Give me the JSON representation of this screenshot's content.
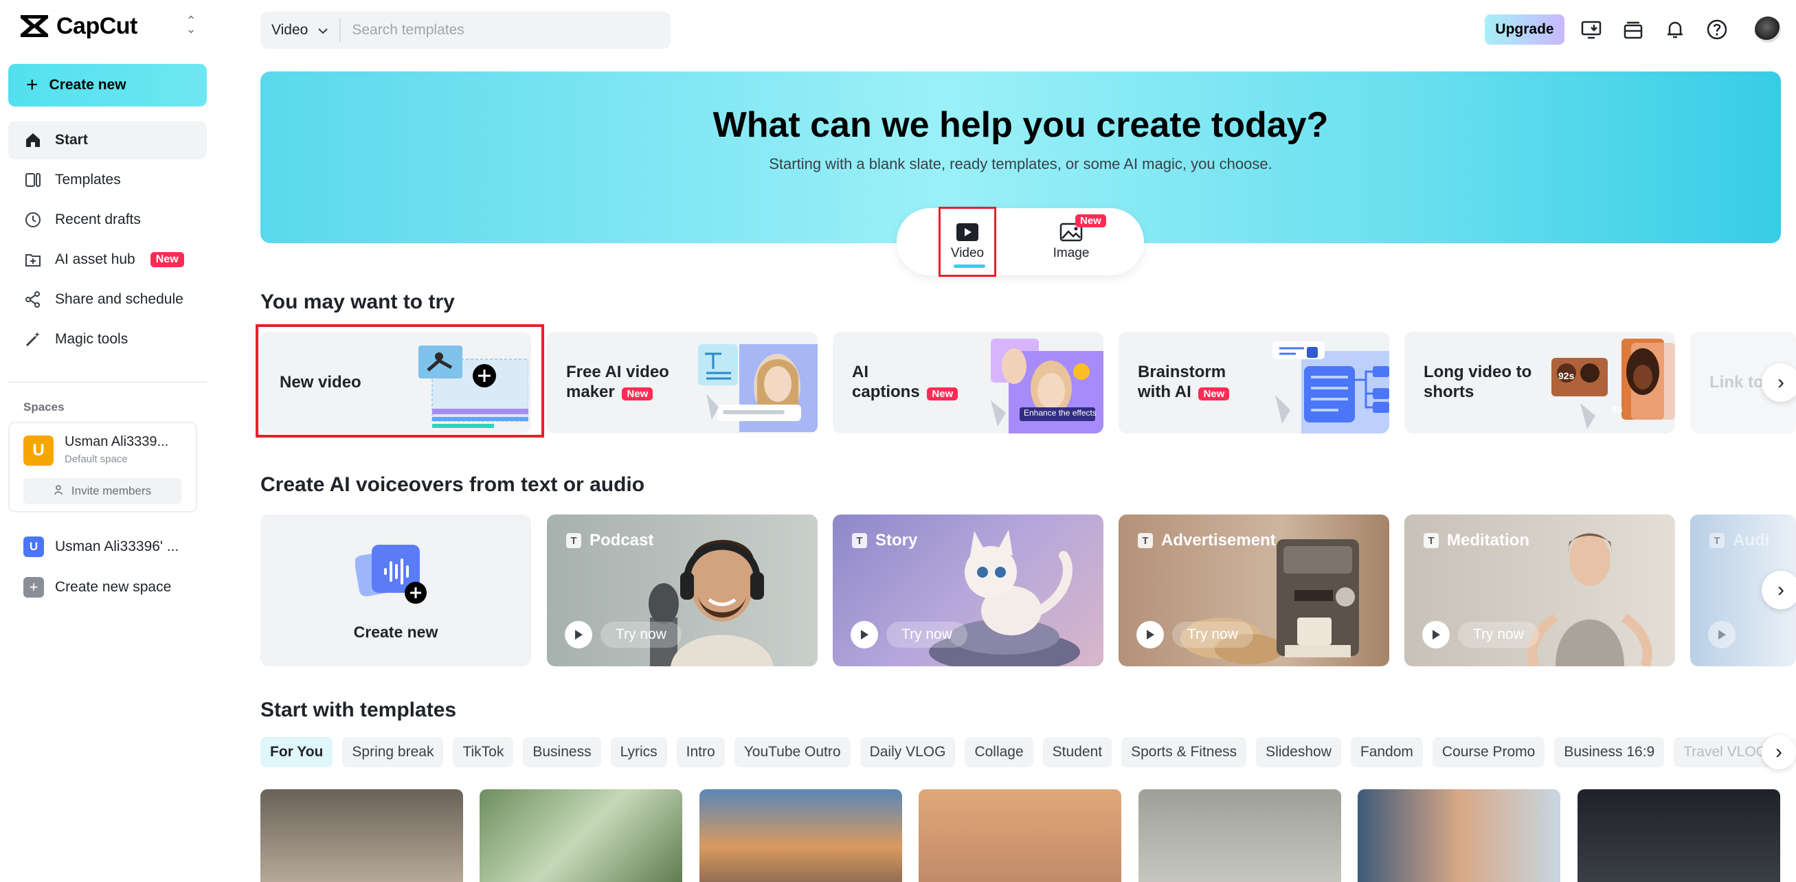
{
  "app": {
    "name": "CapCut"
  },
  "sidebar": {
    "create_label": "Create new",
    "items": [
      {
        "label": "Start",
        "icon": "home-icon"
      },
      {
        "label": "Templates",
        "icon": "templates-icon"
      },
      {
        "label": "Recent drafts",
        "icon": "clock-icon"
      },
      {
        "label": "AI asset hub",
        "icon": "asset-hub-icon",
        "badge": "New"
      },
      {
        "label": "Share and schedule",
        "icon": "share-icon"
      },
      {
        "label": "Magic tools",
        "icon": "magic-wand-icon"
      }
    ],
    "spaces_label": "Spaces",
    "current_space": {
      "initial": "U",
      "name": "Usman Ali3339...",
      "subtitle": "Default space",
      "invite_label": "Invite members"
    },
    "other_space": {
      "initial": "U",
      "name": "Usman Ali33396' ..."
    },
    "create_space_label": "Create new space"
  },
  "topbar": {
    "search_type": "Video",
    "search_placeholder": "Search templates",
    "upgrade_label": "Upgrade"
  },
  "hero": {
    "title": "What can we help you create today?",
    "subtitle": "Starting with a blank slate, ready templates, or some AI magic, you choose.",
    "modes": [
      {
        "label": "Video",
        "selected": true
      },
      {
        "label": "Image",
        "badge": "New"
      }
    ]
  },
  "try_section": {
    "title": "You may want to try",
    "cards": [
      {
        "label": "New video"
      },
      {
        "label_line1": "Free AI video",
        "label_line2": "maker",
        "badge": "New"
      },
      {
        "label_line1": "AI",
        "label_line2": "captions",
        "badge": "New",
        "overlay_text": "Enhance the effects"
      },
      {
        "label_line1": "Brainstorm",
        "label_line2": "with AI",
        "badge": "New"
      },
      {
        "label_line1": "Long video to",
        "label_line2": "shorts",
        "tag1": "92s",
        "tag2": "8s"
      },
      {
        "label": "Link to"
      }
    ]
  },
  "voice_section": {
    "title": "Create AI voiceovers from text or audio",
    "create_label": "Create new",
    "try_label": "Try now",
    "cards": [
      {
        "title": "Podcast"
      },
      {
        "title": "Story"
      },
      {
        "title": "Advertisement"
      },
      {
        "title": "Meditation"
      },
      {
        "title": "Audi"
      }
    ]
  },
  "templates_section": {
    "title": "Start with templates",
    "chips": [
      "For You",
      "Spring break",
      "TikTok",
      "Business",
      "Lyrics",
      "Intro",
      "YouTube Outro",
      "Daily VLOG",
      "Collage",
      "Student",
      "Sports & Fitness",
      "Slideshow",
      "Fandom",
      "Course Promo",
      "Business 16:9",
      "Travel VLOG"
    ],
    "active_chip": "For You"
  },
  "colors": {
    "accent": "#37cde6",
    "badge": "#fe2c55",
    "highlight": "#e5212b"
  }
}
